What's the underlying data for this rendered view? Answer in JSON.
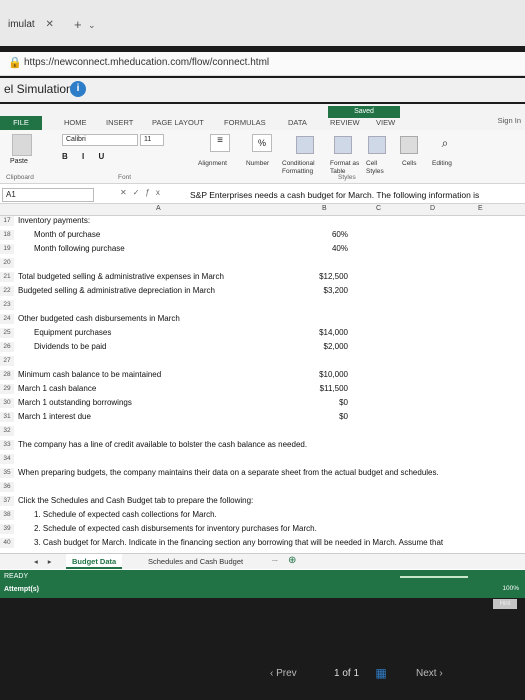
{
  "browser": {
    "tab_title": "imulat",
    "url": "https://newconnect.mheducation.com/flow/connect.html"
  },
  "app": {
    "title": "el Simulation"
  },
  "excel": {
    "saved_label": "Saved",
    "sign_in": "Sign In",
    "ribbon_tabs": [
      "FILE",
      "HOME",
      "INSERT",
      "PAGE LAYOUT",
      "FORMULAS",
      "DATA",
      "REVIEW",
      "VIEW"
    ],
    "font_name": "Calibri",
    "font_size": "11",
    "format_buttons": "B I U",
    "groups": {
      "clipboard": "Clipboard",
      "font": "Font",
      "styles": "Styles"
    },
    "ribbon_labels": {
      "paste": "Paste",
      "alignment": "Alignment",
      "number": "Number",
      "conditional": "Conditional Formatting",
      "format_as": "Format as Table",
      "cell_styles": "Cell Styles",
      "cells": "Cells",
      "editing": "Editing"
    },
    "name_box": "A1",
    "formula": "S&P Enterprises needs a cash budget for March. The following information is",
    "columns": [
      "A",
      "B",
      "C",
      "D",
      "E"
    ],
    "rows": [
      {
        "n": "17",
        "text": "Inventory payments:",
        "value": "",
        "indent": false
      },
      {
        "n": "18",
        "text": "Month of purchase",
        "value": "60%",
        "indent": true
      },
      {
        "n": "19",
        "text": "Month following purchase",
        "value": "40%",
        "indent": true
      },
      {
        "n": "20",
        "text": "",
        "value": "",
        "indent": false
      },
      {
        "n": "21",
        "text": "Total budgeted selling & administrative expenses in March",
        "value": "$12,500",
        "indent": false
      },
      {
        "n": "22",
        "text": "Budgeted selling & administrative depreciation in March",
        "value": "$3,200",
        "indent": false
      },
      {
        "n": "23",
        "text": "",
        "value": "",
        "indent": false
      },
      {
        "n": "24",
        "text": "Other budgeted cash disbursements in March",
        "value": "",
        "indent": false
      },
      {
        "n": "25",
        "text": "Equipment purchases",
        "value": "$14,000",
        "indent": true
      },
      {
        "n": "26",
        "text": "Dividends to be paid",
        "value": "$2,000",
        "indent": true
      },
      {
        "n": "27",
        "text": "",
        "value": "",
        "indent": false
      },
      {
        "n": "28",
        "text": "Minimum cash balance to be maintained",
        "value": "$10,000",
        "indent": false
      },
      {
        "n": "29",
        "text": "March 1 cash balance",
        "value": "$11,500",
        "indent": false
      },
      {
        "n": "30",
        "text": "March 1 outstanding borrowings",
        "value": "$0",
        "indent": false
      },
      {
        "n": "31",
        "text": "March 1 interest due",
        "value": "$0",
        "indent": false
      },
      {
        "n": "32",
        "text": "",
        "value": "",
        "indent": false
      },
      {
        "n": "33",
        "text": "The company has a line of credit available to bolster the cash balance as needed.",
        "value": "",
        "indent": false
      },
      {
        "n": "34",
        "text": "",
        "value": "",
        "indent": false
      },
      {
        "n": "35",
        "text": "When preparing budgets, the company maintains their data on a separate sheet from the actual budget and schedules.",
        "value": "",
        "indent": false
      },
      {
        "n": "36",
        "text": "",
        "value": "",
        "indent": false
      },
      {
        "n": "37",
        "text": "Click the Schedules and Cash Budget tab to prepare the following:",
        "value": "",
        "indent": false
      },
      {
        "n": "38",
        "text": "1. Schedule of expected cash collections for March.",
        "value": "",
        "indent": true
      },
      {
        "n": "39",
        "text": "2. Schedule of expected cash disbursements for inventory purchases for March.",
        "value": "",
        "indent": true
      },
      {
        "n": "40",
        "text": "3. Cash budget for March. Indicate in the financing section any borrowing that will be needed in March. Assume that",
        "value": "",
        "indent": true
      }
    ],
    "sheet_tabs": [
      "Budget Data",
      "Schedules and Cash Budget"
    ],
    "sheet_more": "...",
    "status": "READY",
    "attempt_label": "Attempt(s)",
    "zoom": "100%",
    "hint_label": "Hint"
  },
  "pager": {
    "prev": "Prev",
    "position": "1 of 1",
    "next": "Next"
  }
}
